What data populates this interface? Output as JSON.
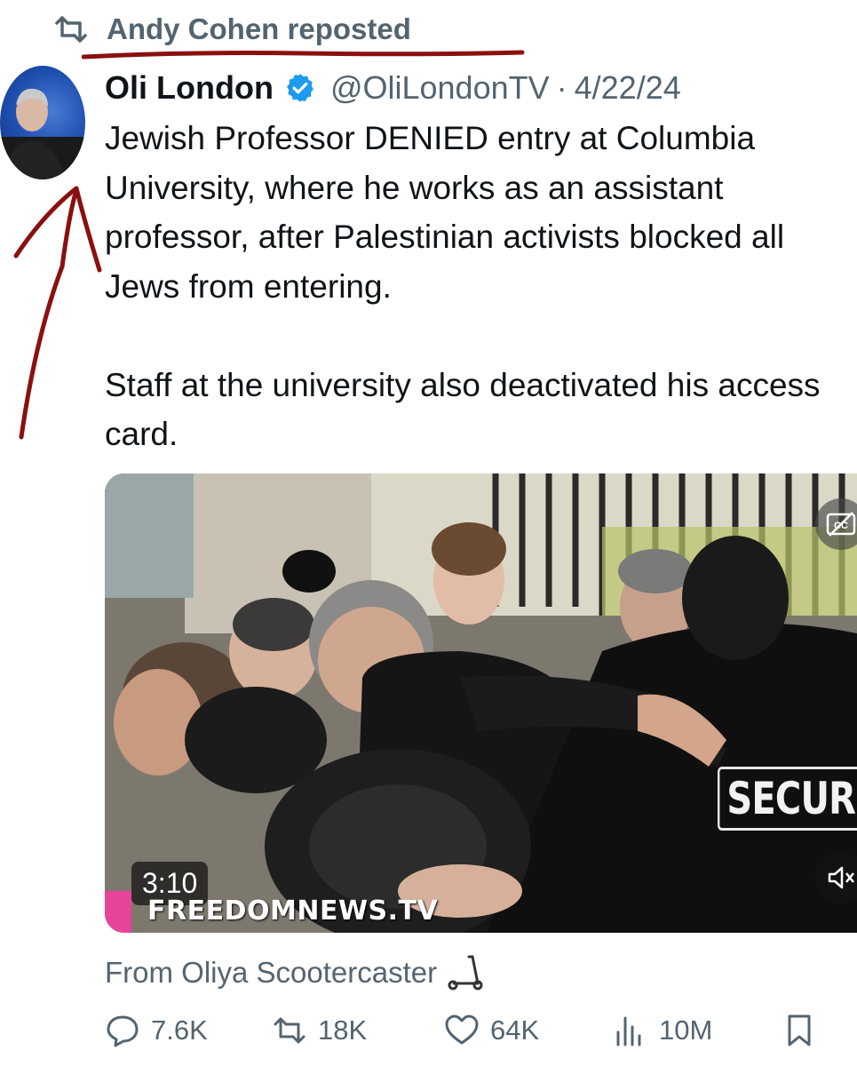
{
  "repost": {
    "label": "Andy Cohen reposted",
    "icon": "repost-icon"
  },
  "tweet": {
    "author_name": "Oli London",
    "handle": "@OliLondonTV",
    "separator": "·",
    "date": "4/22/24",
    "text": "Jewish Professor DENIED entry at Columbia University, where he works as an assistant professor, after Palestinian activists blocked all Jews from entering.\n\nStaff at the university also deactivated his access card.",
    "avatar_icon": "avatar"
  },
  "media": {
    "duration": "3:10",
    "watermark": "FREEDOMNEWS.TV",
    "patch_text": "SECURIT",
    "cc_icon": "captions-icon",
    "mute_icon": "mute-icon"
  },
  "source": {
    "text": "From Oliya Scootercaster",
    "icon": "scooter-icon"
  },
  "actions": {
    "replies": "7.6K",
    "reposts": "18K",
    "likes": "64K",
    "views": "10M"
  },
  "colors": {
    "muted_text": "#536471",
    "verified": "#1d9bf0",
    "annotation": "#8a1010"
  }
}
